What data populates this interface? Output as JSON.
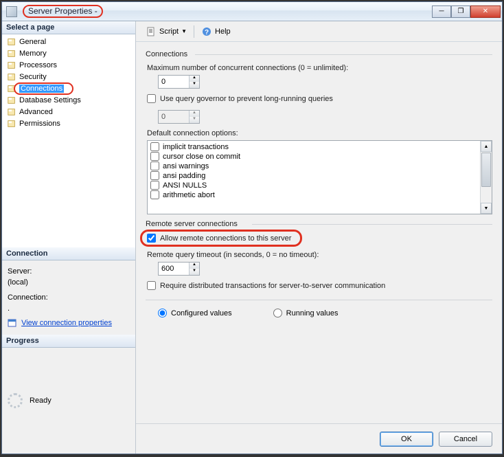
{
  "title": "Server Properties -",
  "toolbar": {
    "script": "Script",
    "help": "Help"
  },
  "sidebar": {
    "header": "Select a page",
    "items": [
      {
        "label": "General"
      },
      {
        "label": "Memory"
      },
      {
        "label": "Processors"
      },
      {
        "label": "Security"
      },
      {
        "label": "Connections",
        "selected": true
      },
      {
        "label": "Database Settings"
      },
      {
        "label": "Advanced"
      },
      {
        "label": "Permissions"
      }
    ]
  },
  "connection_panel": {
    "header": "Connection",
    "server_label": "Server:",
    "server_value": "(local)",
    "connection_label": "Connection:",
    "view_props": "View connection properties"
  },
  "progress_panel": {
    "header": "Progress",
    "status": "Ready"
  },
  "main": {
    "group_connections": "Connections",
    "max_conn_label": "Maximum number of concurrent connections (0 = unlimited):",
    "max_conn_value": "0",
    "governor_label": "Use query governor to prevent long-running queries",
    "governor_value": "0",
    "default_opts_label": "Default connection options:",
    "options": [
      "implicit transactions",
      "cursor close on commit",
      "ansi warnings",
      "ansi padding",
      "ANSI NULLS",
      "arithmetic abort"
    ],
    "group_remote": "Remote server connections",
    "allow_remote_label": "Allow remote connections to this server",
    "remote_timeout_label": "Remote query timeout (in seconds, 0 = no timeout):",
    "remote_timeout_value": "600",
    "require_dist_label": "Require distributed transactions for server-to-server communication",
    "configured_label": "Configured values",
    "running_label": "Running values"
  },
  "footer": {
    "ok": "OK",
    "cancel": "Cancel"
  }
}
